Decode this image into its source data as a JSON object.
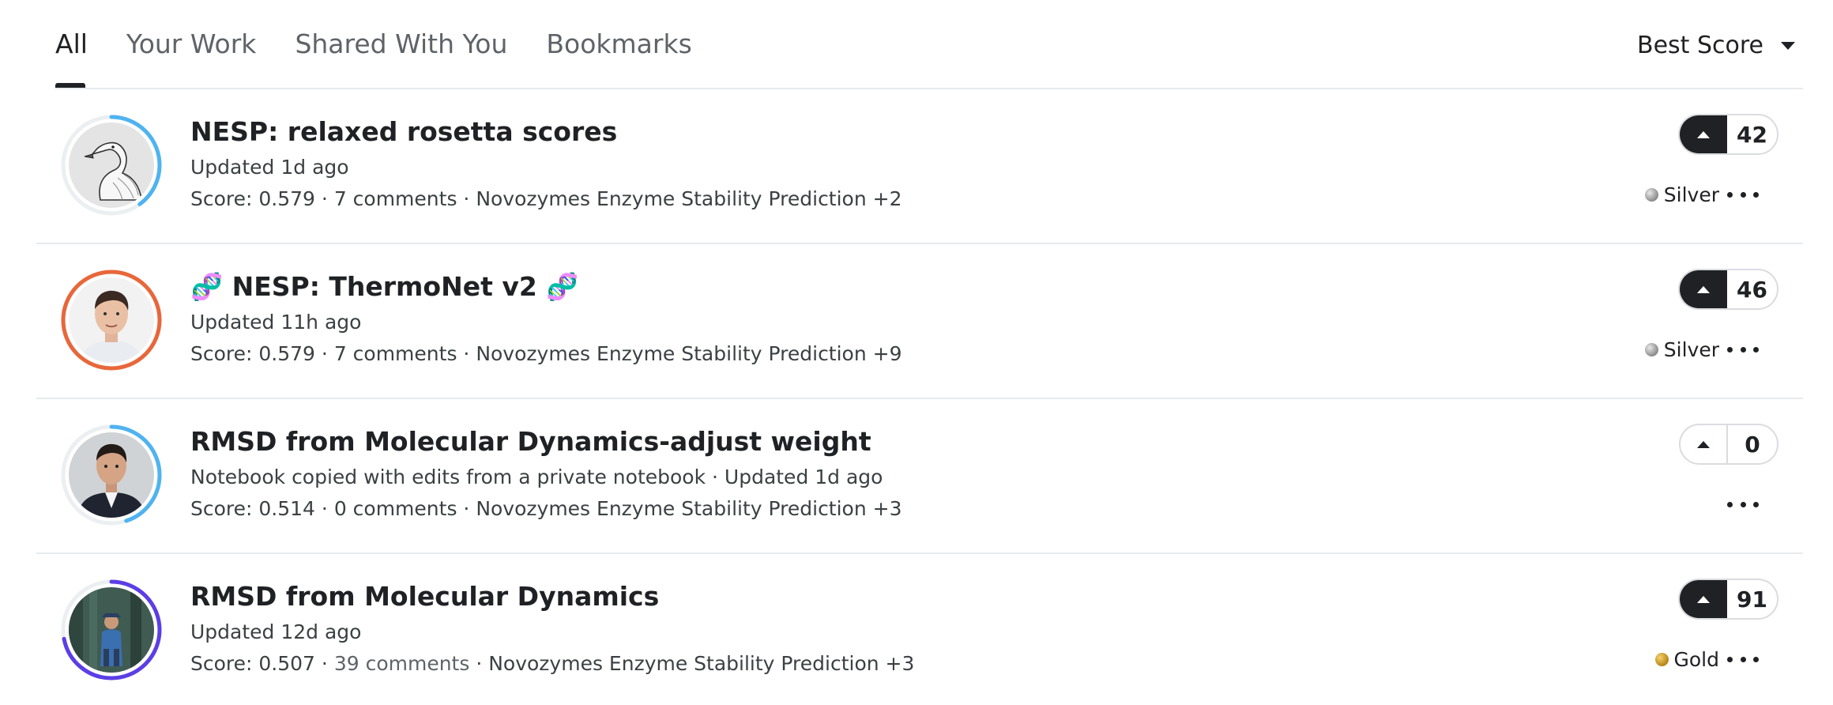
{
  "tabs": [
    {
      "label": "All",
      "active": true
    },
    {
      "label": "Your Work",
      "active": false
    },
    {
      "label": "Shared With You",
      "active": false
    },
    {
      "label": "Bookmarks",
      "active": false
    }
  ],
  "sort": {
    "label": "Best Score"
  },
  "notebooks": [
    {
      "title": "NESP: relaxed rosetta scores",
      "updated": "Updated 1d ago",
      "score": "Score: 0.579",
      "comments": "7 comments",
      "competition": "Novozymes Enzyme Stability Prediction +2",
      "votes": "42",
      "voted": true,
      "medal": "Silver",
      "ring_color": "#4fb3f0",
      "ring_fraction": 0.4
    },
    {
      "title": "🧬 NESP: ThermoNet v2 🧬",
      "updated": "Updated 11h ago",
      "score": "Score: 0.579",
      "comments": "7 comments",
      "competition": "Novozymes Enzyme Stability Prediction +9",
      "votes": "46",
      "voted": true,
      "medal": "Silver",
      "ring_color": "#e8673a",
      "ring_fraction": 1.0
    },
    {
      "title": "RMSD from Molecular Dynamics-adjust weight",
      "updated": "Notebook copied with edits from a private notebook · Updated 1d ago",
      "score": "Score: 0.514",
      "comments": "0 comments",
      "competition": "Novozymes Enzyme Stability Prediction +3",
      "votes": "0",
      "voted": false,
      "medal": "",
      "ring_color": "#4fb3f0",
      "ring_fraction": 0.45
    },
    {
      "title": "RMSD from Molecular Dynamics",
      "updated": "Updated 12d ago",
      "score": "Score: 0.507",
      "comments": "39 comments",
      "competition": "Novozymes Enzyme Stability Prediction +3",
      "votes": "91",
      "voted": true,
      "medal": "Gold",
      "ring_color": "#5b3ee6",
      "ring_fraction": 0.72
    }
  ],
  "separator": " · ",
  "colors": {
    "silver": "#9aa0a6",
    "gold": "#c9962a",
    "text": "#202124",
    "muted": "#5f6368"
  }
}
